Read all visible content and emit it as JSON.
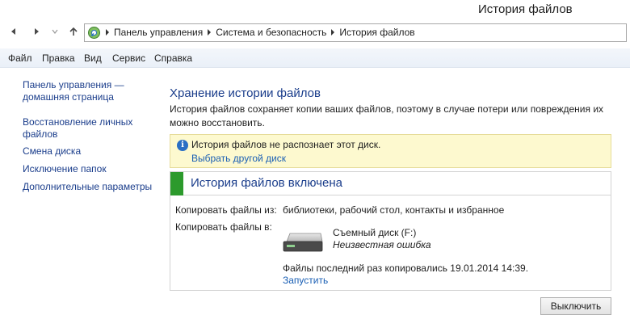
{
  "window": {
    "title": "История файлов"
  },
  "nav": {
    "breadcrumbs": [
      "Панель управления",
      "Система и безопасность",
      "История файлов"
    ]
  },
  "menu": [
    "Файл",
    "Правка",
    "Вид",
    "Сервис",
    "Справка"
  ],
  "sidebar": {
    "items": [
      {
        "label": "Панель управления — домашняя страница"
      },
      {
        "label": "Восстановление личных файлов"
      },
      {
        "label": "Смена диска"
      },
      {
        "label": "Исключение папок"
      },
      {
        "label": "Дополнительные параметры"
      }
    ]
  },
  "main": {
    "title": "Хранение истории файлов",
    "description": "История файлов сохраняет копии ваших файлов, поэтому в случае потери или повреждения их можно восстановить.",
    "warning": {
      "text": "История файлов не распознает этот диск.",
      "link": "Выбрать другой диск"
    },
    "status": {
      "title": "История файлов включена",
      "copy_from_label": "Копировать файлы из:",
      "copy_from_value": "библиотеки, рабочий стол, контакты и избранное",
      "copy_to_label": "Копировать файлы в:",
      "drive_name": "Съемный диск (F:)",
      "drive_error": "Неизвестная ошибка",
      "last_copy": "Файлы последний раз копировались 19.01.2014 14:39.",
      "run_link": "Запустить"
    },
    "off_button": "Выключить"
  },
  "colors": {
    "link": "#1a3d8b",
    "status_green": "#2c9a2c",
    "warning_bg": "#fdf9cf"
  }
}
